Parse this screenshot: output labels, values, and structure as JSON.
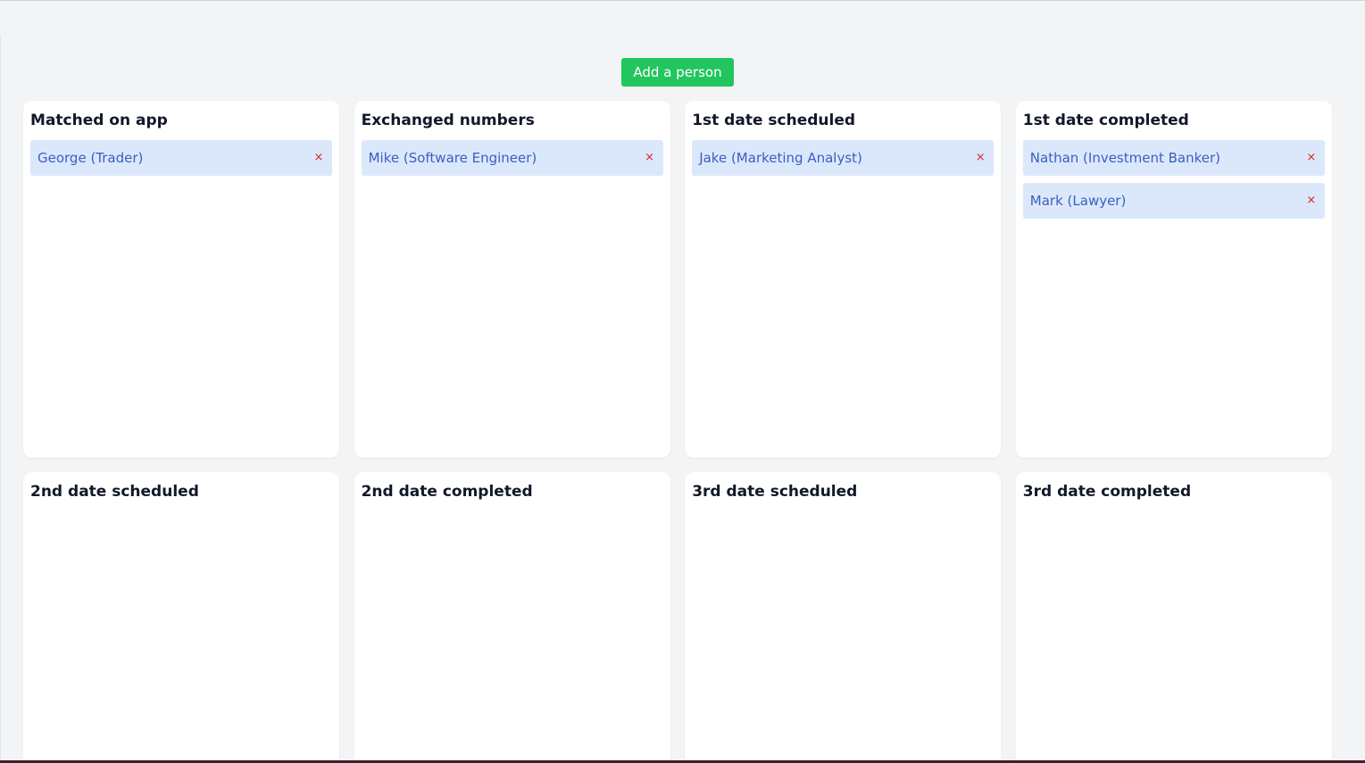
{
  "toolbar": {
    "add_label": "Add a person"
  },
  "columns": [
    {
      "title": "Matched on app",
      "cards": [
        {
          "label": "George (Trader)",
          "remove": "×"
        }
      ]
    },
    {
      "title": "Exchanged numbers",
      "cards": [
        {
          "label": "Mike (Software Engineer)",
          "remove": "×"
        }
      ]
    },
    {
      "title": "1st date scheduled",
      "cards": [
        {
          "label": "Jake (Marketing Analyst)",
          "remove": "×"
        }
      ]
    },
    {
      "title": "1st date completed",
      "cards": [
        {
          "label": "Nathan (Investment Banker)",
          "remove": "×"
        },
        {
          "label": "Mark (Lawyer)",
          "remove": "×"
        }
      ]
    },
    {
      "title": "2nd date scheduled",
      "cards": []
    },
    {
      "title": "2nd date completed",
      "cards": []
    },
    {
      "title": "3rd date scheduled",
      "cards": []
    },
    {
      "title": "3rd date completed",
      "cards": []
    }
  ],
  "colors": {
    "accent": "#22c55e",
    "card_bg": "#dbe8fc",
    "card_text": "#3b5fc0",
    "remove": "#dc2626"
  }
}
